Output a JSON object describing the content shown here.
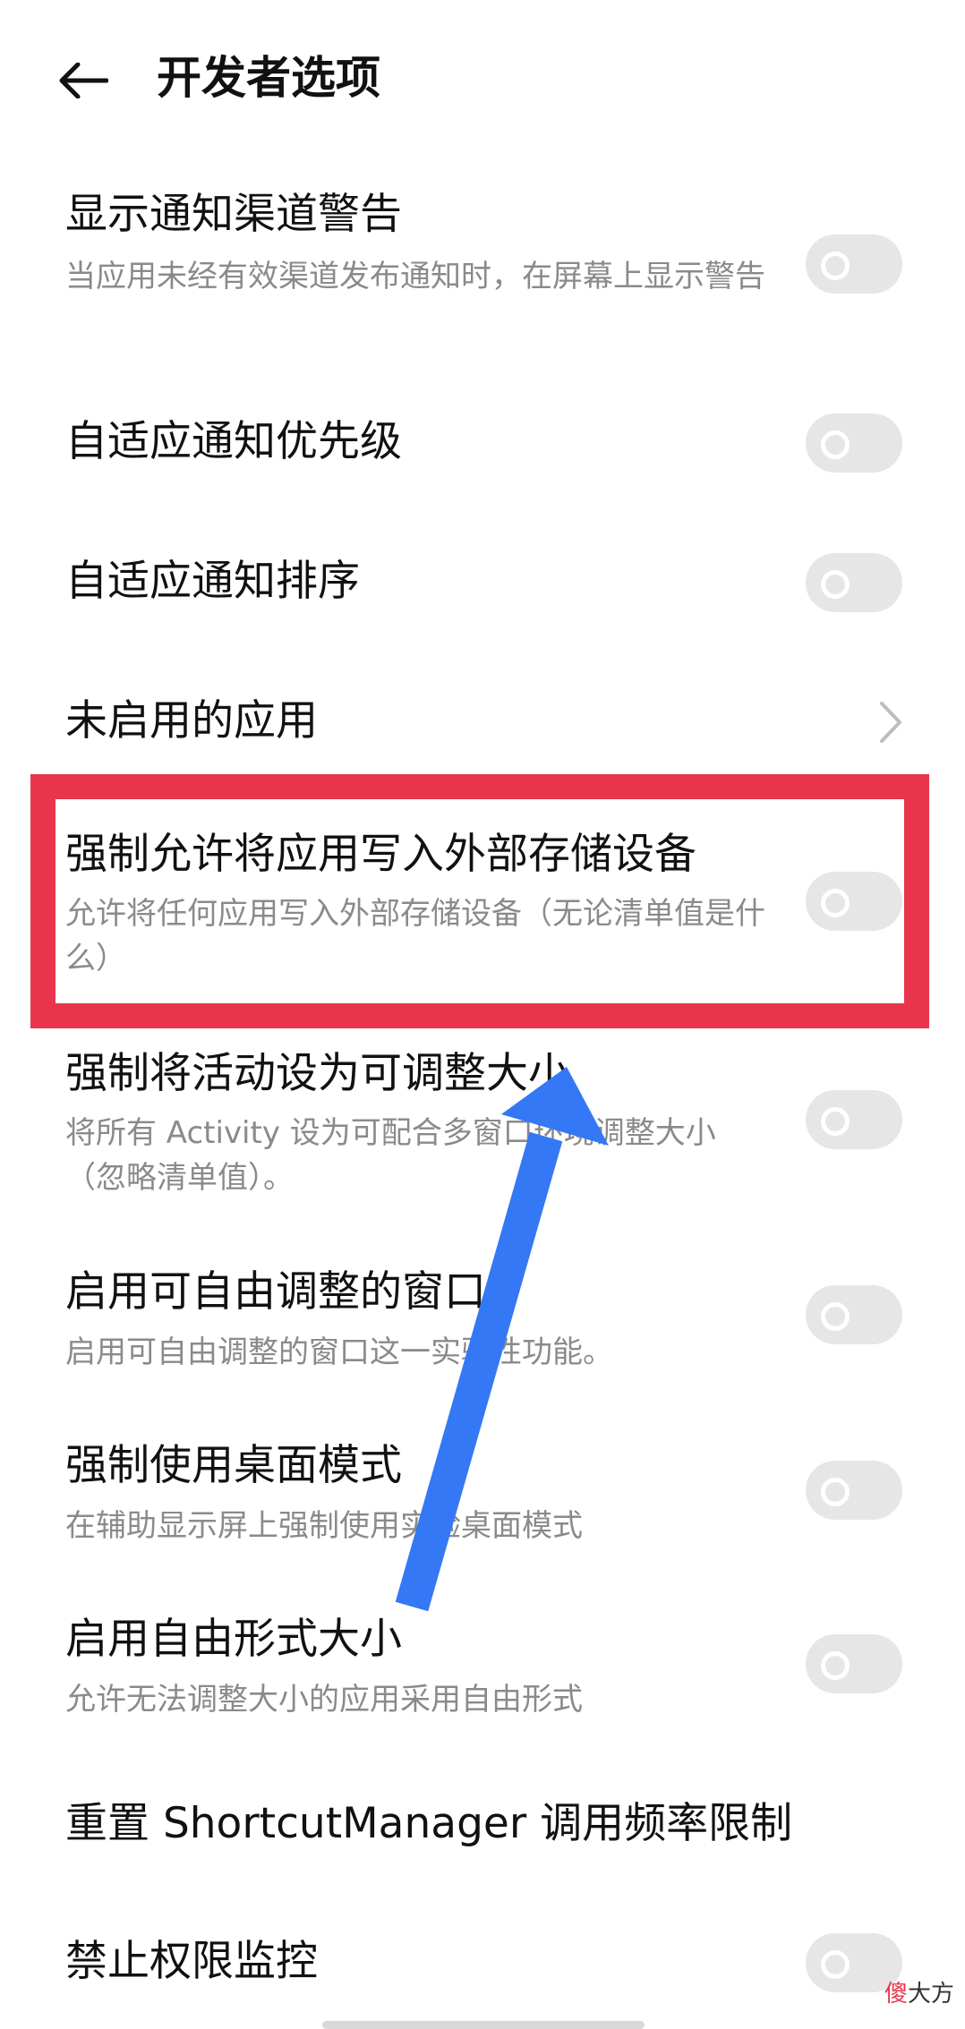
{
  "header": {
    "title": "开发者选项"
  },
  "settings": [
    {
      "title": "显示通知渠道警告",
      "subtitle": "当应用未经有效渠道发布通知时，在屏幕上显示警告",
      "control": "toggle",
      "on": false
    },
    {
      "title": "自适应通知优先级",
      "control": "toggle",
      "on": false
    },
    {
      "title": "自适应通知排序",
      "control": "toggle",
      "on": false
    },
    {
      "title": "未启用的应用",
      "control": "chevron"
    },
    {
      "title": "强制允许将应用写入外部存储设备",
      "subtitle": "允许将任何应用写入外部存储设备（无论清单值是什么）",
      "control": "toggle",
      "on": false,
      "highlighted": true
    },
    {
      "title": "强制将活动设为可调整大小",
      "subtitle": "将所有 Activity 设为可配合多窗口环境调整大小（忽略清单值）。",
      "control": "toggle",
      "on": false
    },
    {
      "title": "启用可自由调整的窗口",
      "subtitle": "启用可自由调整的窗口这一实验性功能。",
      "control": "toggle",
      "on": false
    },
    {
      "title": "强制使用桌面模式",
      "subtitle": "在辅助显示屏上强制使用实验桌面模式",
      "control": "toggle",
      "on": false
    },
    {
      "title": "启用自由形式大小",
      "subtitle": "允许无法调整大小的应用采用自由形式",
      "control": "toggle",
      "on": false
    },
    {
      "title": "重置 ShortcutManager 调用频率限制",
      "control": "none"
    },
    {
      "title": "禁止权限监控",
      "control": "toggle",
      "on": false
    }
  ],
  "annotations": {
    "highlight_color": "#e8354b",
    "arrow_color": "#3478f6"
  },
  "watermark": {
    "first": "傻",
    "rest": "大方"
  },
  "colors": {
    "background": "#ffffff",
    "title_text": "#111111",
    "subtitle_text": "#8a8a8a",
    "toggle_off_track": "#e6e6e6"
  },
  "icons": {
    "back": "arrow-left-icon",
    "chevron": "chevron-right-icon"
  }
}
